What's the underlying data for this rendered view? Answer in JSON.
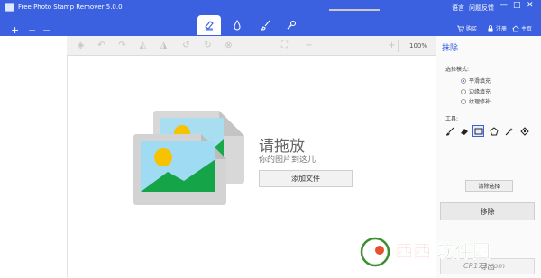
{
  "app": {
    "title": "Free Photo Stamp Remover 5.0.0",
    "add_symbol": "+",
    "remove_symbol": "−",
    "minus_symbol": "−"
  },
  "tool_tabs": [
    {
      "icon": "crop-icon"
    },
    {
      "icon": "eraser-icon",
      "active": true
    },
    {
      "icon": "droplet-icon"
    },
    {
      "icon": "brush-icon"
    },
    {
      "icon": "stamp-icon"
    }
  ],
  "top_links": {
    "language": "语言",
    "feedback": "问题反馈",
    "purchase": "购买",
    "register": "注册",
    "home": "主页"
  },
  "window_controls": {
    "minimize": "—",
    "maximize": "□",
    "close": "✕"
  },
  "edit_toolbar": {
    "zoom_minus": "−",
    "zoom_plus": "+",
    "zoom_level": "100%",
    "zoom_fraction": 0.15
  },
  "canvas": {
    "drop_title": "请拖放",
    "drop_subtitle": "你的图片到这儿",
    "add_file_label": "添加文件"
  },
  "right_panel": {
    "title": "抹除",
    "mode_label": "选择模式:",
    "modes": [
      {
        "label": "平滑填充",
        "selected": true
      },
      {
        "label": "边缘填充",
        "selected": false
      },
      {
        "label": "纹理修补",
        "selected": false
      }
    ],
    "tools_label": "工具:",
    "clear_selection_label": "清除选择",
    "remove_label": "移除",
    "export_label": "导出"
  },
  "watermark": {
    "name": "西西软件园",
    "domain": "CR173.com"
  },
  "colors": {
    "accent": "#3b61e0",
    "titlebar": "#3b61e0"
  }
}
